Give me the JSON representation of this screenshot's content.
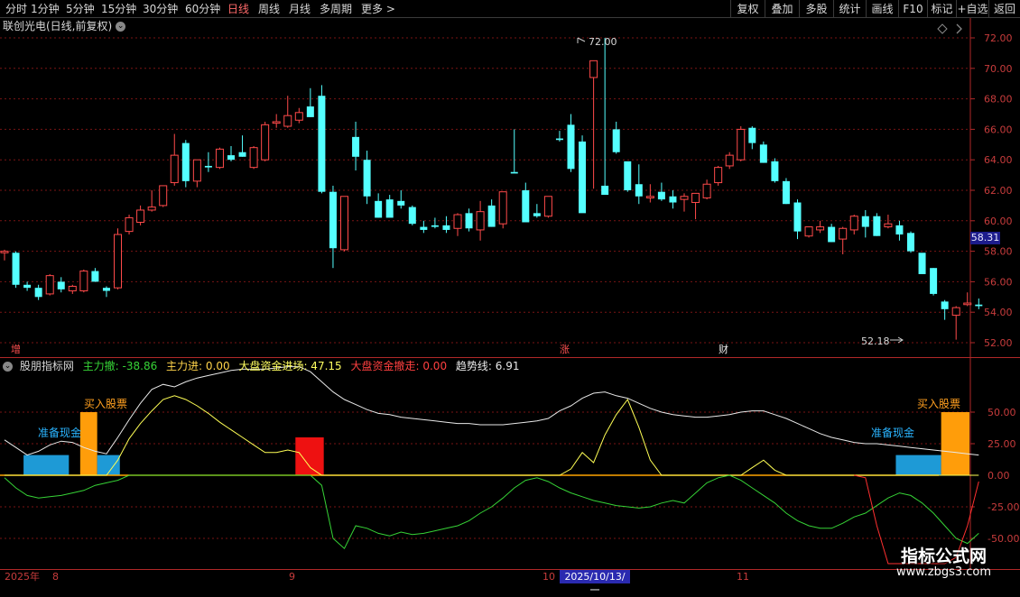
{
  "toolbar": {
    "periods": [
      "分时",
      "1分钟",
      "5分钟",
      "15分钟",
      "30分钟",
      "60分钟",
      "日线",
      "周线",
      "月线",
      "多周期",
      "更多 >"
    ],
    "active_period": "日线",
    "right_buttons": [
      "复权",
      "叠加",
      "多股",
      "统计",
      "画线",
      "F10",
      "标记",
      "+自选",
      "返回"
    ]
  },
  "stock_title": "联创光电(日线,前复权)",
  "price_axis": {
    "ticks": [
      "72.00",
      "70.00",
      "68.00",
      "66.00",
      "64.00",
      "62.00",
      "60.00",
      "58.00",
      "56.00",
      "54.00",
      "52.00"
    ],
    "current_price": "58.31",
    "max_label": "72.00",
    "min_label": "52.18"
  },
  "event_labels": [
    {
      "text": "增",
      "color": "#ff5050"
    },
    {
      "text": "涨",
      "color": "#ff5050"
    },
    {
      "text": "财",
      "color": "#e8e8e8"
    }
  ],
  "indicator": {
    "name": "股朋指标网",
    "values": [
      {
        "label": "主力撤: -38.86",
        "color": "#36d336"
      },
      {
        "label": "主力进: 0.00",
        "color": "#ffd34a"
      },
      {
        "label": "大盘资金进场: 47.15",
        "color": "#ffff60"
      },
      {
        "label": "大盘资金撤走: 0.00",
        "color": "#ff4040"
      },
      {
        "label": "趋势线: 6.91",
        "color": "#e8e8e8"
      }
    ],
    "ticks": [
      "50.00",
      "25.00",
      "0.00",
      "-25.00",
      "-50.00"
    ],
    "signals": {
      "buy": "买入股票",
      "prepare": "准备现金"
    }
  },
  "date_axis": {
    "labels": [
      "2025年",
      "8",
      "9",
      "10",
      "11"
    ],
    "highlight": "2025/10/13/一"
  },
  "watermark": {
    "main": "指标公式网",
    "sub": "www.zbgs3.com"
  },
  "colors": {
    "up": "#ff4a4a",
    "down": "#54ffff",
    "bg": "#000000",
    "grid": "#7a1414",
    "axis_text": "#c83c3c"
  },
  "chart_data": {
    "type": "candlestick",
    "price_ylim": [
      51.2,
      73.0
    ],
    "candles": [
      [
        57.9,
        58.1,
        57.4,
        58.0
      ],
      [
        57.9,
        58.0,
        55.6,
        55.8
      ],
      [
        55.8,
        56.0,
        55.4,
        55.6
      ],
      [
        55.6,
        55.8,
        54.8,
        55.0
      ],
      [
        55.2,
        56.5,
        55.1,
        56.4
      ],
      [
        56.0,
        56.3,
        55.3,
        55.5
      ],
      [
        55.4,
        55.8,
        55.2,
        55.7
      ],
      [
        55.4,
        56.8,
        55.3,
        56.7
      ],
      [
        56.7,
        56.9,
        56.0,
        56.0
      ],
      [
        55.6,
        55.7,
        55.0,
        55.4
      ],
      [
        55.6,
        59.5,
        55.5,
        59.1
      ],
      [
        59.3,
        60.4,
        59.1,
        60.2
      ],
      [
        59.9,
        61.0,
        59.7,
        60.7
      ],
      [
        60.7,
        62.0,
        60.6,
        60.9
      ],
      [
        61.0,
        62.2,
        60.9,
        62.3
      ],
      [
        62.5,
        65.7,
        62.3,
        64.3
      ],
      [
        65.1,
        65.3,
        62.2,
        62.6
      ],
      [
        62.6,
        64.0,
        62.2,
        64.0
      ],
      [
        63.6,
        64.5,
        63.2,
        63.5
      ],
      [
        63.5,
        64.8,
        63.4,
        64.7
      ],
      [
        64.3,
        64.9,
        63.9,
        64.0
      ],
      [
        64.5,
        65.6,
        64.2,
        64.2
      ],
      [
        63.5,
        64.9,
        63.4,
        64.8
      ],
      [
        64.0,
        66.5,
        63.9,
        66.3
      ],
      [
        66.4,
        67.0,
        66.1,
        66.5
      ],
      [
        66.2,
        68.2,
        66.1,
        66.9
      ],
      [
        66.6,
        67.4,
        66.4,
        67.1
      ],
      [
        67.5,
        68.7,
        66.8,
        66.8
      ],
      [
        68.2,
        68.9,
        61.8,
        61.9
      ],
      [
        61.9,
        62.3,
        56.9,
        58.2
      ],
      [
        58.1,
        61.5,
        58.0,
        61.6
      ],
      [
        65.5,
        66.5,
        63.3,
        64.2
      ],
      [
        64.0,
        64.6,
        61.1,
        61.6
      ],
      [
        61.3,
        61.8,
        60.2,
        60.2
      ],
      [
        61.4,
        61.7,
        60.3,
        60.2
      ],
      [
        61.3,
        62.0,
        60.8,
        61.0
      ],
      [
        60.9,
        61.0,
        59.7,
        59.8
      ],
      [
        59.6,
        60.0,
        59.2,
        59.4
      ],
      [
        59.7,
        60.2,
        59.5,
        59.6
      ],
      [
        59.7,
        60.3,
        59.2,
        59.4
      ],
      [
        59.5,
        60.5,
        59.0,
        60.4
      ],
      [
        60.5,
        60.8,
        59.3,
        59.5
      ],
      [
        59.4,
        61.3,
        58.7,
        60.6
      ],
      [
        61.0,
        61.4,
        59.6,
        59.6
      ],
      [
        59.8,
        61.9,
        59.5,
        61.9
      ],
      [
        63.2,
        66.0,
        63.2,
        63.1
      ],
      [
        62.0,
        62.5,
        59.9,
        59.9
      ],
      [
        60.5,
        61.1,
        60.2,
        60.3
      ],
      [
        60.3,
        61.6,
        60.2,
        61.6
      ],
      [
        65.4,
        65.9,
        65.2,
        65.3
      ],
      [
        66.3,
        67.0,
        63.2,
        63.4
      ],
      [
        65.2,
        65.6,
        60.7,
        60.5
      ],
      [
        69.4,
        70.5,
        62.1,
        70.5
      ],
      [
        62.3,
        72.0,
        62.0,
        61.7
      ],
      [
        66.0,
        66.5,
        64.4,
        64.5
      ],
      [
        63.9,
        63.4,
        61.9,
        62.0
      ],
      [
        62.4,
        63.7,
        61.1,
        61.6
      ],
      [
        61.5,
        62.4,
        61.2,
        61.6
      ],
      [
        61.9,
        62.5,
        61.3,
        61.4
      ],
      [
        61.6,
        62.0,
        60.8,
        61.2
      ],
      [
        61.4,
        61.8,
        60.6,
        61.6
      ],
      [
        61.2,
        61.4,
        60.1,
        61.8
      ],
      [
        61.5,
        62.7,
        61.4,
        62.4
      ],
      [
        62.5,
        63.6,
        62.3,
        63.5
      ],
      [
        63.6,
        64.5,
        63.4,
        64.3
      ],
      [
        64.0,
        66.2,
        63.9,
        66.0
      ],
      [
        66.1,
        66.2,
        64.7,
        65.1
      ],
      [
        65.0,
        65.2,
        63.8,
        63.8
      ],
      [
        63.9,
        64.1,
        62.5,
        62.6
      ],
      [
        62.6,
        62.8,
        61.1,
        61.1
      ],
      [
        61.2,
        61.4,
        58.8,
        59.3
      ],
      [
        59.0,
        59.6,
        58.9,
        59.6
      ],
      [
        59.4,
        60.0,
        59.2,
        59.6
      ],
      [
        59.6,
        59.8,
        58.6,
        58.6
      ],
      [
        58.8,
        59.6,
        57.8,
        59.5
      ],
      [
        59.4,
        60.4,
        59.1,
        60.3
      ],
      [
        60.3,
        60.7,
        58.9,
        59.6
      ],
      [
        60.3,
        60.5,
        59.0,
        59.0
      ],
      [
        59.6,
        60.4,
        59.5,
        59.8
      ],
      [
        59.7,
        60.0,
        58.7,
        59.1
      ],
      [
        59.2,
        59.3,
        57.9,
        58.0
      ],
      [
        57.9,
        57.8,
        56.5,
        56.5
      ],
      [
        56.9,
        56.9,
        55.1,
        55.2
      ],
      [
        54.7,
        54.8,
        53.5,
        54.2
      ],
      [
        53.8,
        54.4,
        52.2,
        54.3
      ],
      [
        54.5,
        55.3,
        54.4,
        54.6
      ],
      [
        54.5,
        54.9,
        54.2,
        54.4
      ]
    ],
    "indicator_ylim": [
      -70,
      85
    ],
    "trend_line": [
      28,
      22,
      16,
      19,
      24,
      27,
      26,
      22,
      19,
      17,
      30,
      44,
      57,
      68,
      72,
      70,
      74,
      77,
      79,
      81,
      83,
      84,
      84,
      84,
      85,
      86,
      86,
      82,
      74,
      66,
      60,
      56,
      52,
      49,
      48,
      46,
      45,
      44,
      43,
      42,
      41,
      41,
      40,
      40,
      40,
      41,
      42,
      43,
      45,
      51,
      55,
      61,
      65,
      66,
      63,
      61,
      57,
      53,
      50,
      48,
      47,
      46,
      46,
      47,
      48,
      50,
      51,
      51,
      48,
      45,
      41,
      37,
      33,
      30,
      28,
      26,
      25,
      25,
      24,
      23,
      22,
      21,
      20,
      19,
      18,
      17,
      16
    ],
    "main_in": [
      0,
      0,
      0,
      0,
      0,
      0,
      0,
      0,
      0,
      0,
      12,
      29,
      41,
      51,
      60,
      63,
      60,
      55,
      49,
      42,
      36,
      30,
      24,
      18,
      18,
      20,
      18,
      6,
      0,
      0,
      0,
      0,
      0,
      0,
      0,
      0,
      0,
      0,
      0,
      0,
      0,
      0,
      0,
      0,
      0,
      0,
      0,
      0,
      0,
      0,
      5,
      18,
      10,
      32,
      48,
      60,
      38,
      12,
      0,
      0,
      0,
      0,
      0,
      0,
      0,
      0,
      6,
      12,
      4,
      0,
      0,
      0,
      0,
      0,
      0,
      0,
      0,
      0,
      0,
      0,
      0,
      0,
      0,
      0,
      0,
      0,
      0
    ],
    "main_out": [
      -2,
      -10,
      -16,
      -18,
      -17,
      -16,
      -14,
      -12,
      -8,
      -6,
      -4,
      0,
      0,
      0,
      0,
      0,
      0,
      0,
      0,
      0,
      0,
      0,
      0,
      0,
      0,
      0,
      0,
      0,
      -8,
      -50,
      -58,
      -40,
      -42,
      -46,
      -48,
      -45,
      -47,
      -46,
      -44,
      -42,
      -40,
      -36,
      -30,
      -25,
      -18,
      -10,
      -4,
      -2,
      -5,
      -10,
      -14,
      -17,
      -20,
      -22,
      -24,
      -25,
      -26,
      -25,
      -22,
      -20,
      -22,
      -14,
      -6,
      -2,
      0,
      -4,
      -10,
      -16,
      -22,
      -30,
      -36,
      -40,
      -42,
      -42,
      -38,
      -33,
      -30,
      -24,
      -18,
      -14,
      -16,
      -22,
      -30,
      -40,
      -50,
      -54,
      -46
    ],
    "market_out": [
      0,
      0,
      0,
      0,
      0,
      0,
      0,
      0,
      0,
      0,
      0,
      0,
      0,
      0,
      0,
      0,
      0,
      0,
      0,
      0,
      0,
      0,
      0,
      0,
      0,
      0,
      0,
      0,
      0,
      0,
      0,
      0,
      0,
      0,
      0,
      0,
      0,
      0,
      0,
      0,
      0,
      0,
      0,
      0,
      0,
      0,
      0,
      0,
      0,
      0,
      0,
      0,
      0,
      0,
      0,
      0,
      0,
      0,
      0,
      0,
      0,
      0,
      0,
      0,
      0,
      0,
      0,
      0,
      0,
      0,
      0,
      0,
      0,
      0,
      0,
      0,
      -2,
      -40,
      -88,
      -112,
      -118,
      -110,
      -95,
      -85,
      -65,
      -40,
      -5
    ],
    "bars": [
      {
        "i": 2,
        "span": 4,
        "value": 16,
        "color": "#1e9ad6"
      },
      {
        "i": 7,
        "span": 1.5,
        "value": 50,
        "color": "#ff9d0a"
      },
      {
        "i": 8.5,
        "span": 2,
        "value": 16,
        "color": "#1e9ad6"
      },
      {
        "i": 26,
        "span": 2.5,
        "value": 30,
        "color": "#ee1111"
      },
      {
        "i": 79,
        "span": 4,
        "value": 16,
        "color": "#1e9ad6"
      },
      {
        "i": 83,
        "span": 2.5,
        "value": 50,
        "color": "#ff9d0a"
      }
    ]
  }
}
